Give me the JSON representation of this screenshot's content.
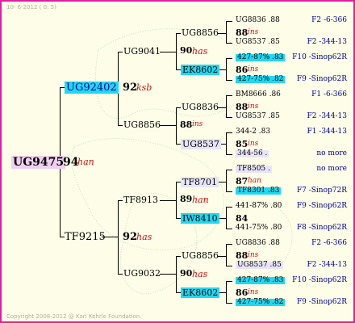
{
  "header": {
    "date_text": "10- 6-2012 ( 0: 5)"
  },
  "footer": {
    "copyright": "Copyright 2008-2012 @ Karl Kehrle Foundation."
  },
  "colors": {
    "border": "#e020a0",
    "background": "#fdfde8",
    "highlight_cyan": "#20d8f0",
    "highlight_lavender": "#e8e4f8",
    "highlight_pink": "#f0d0f0",
    "score_red": "#d01010",
    "info_blue": "#0000a0"
  },
  "root": {
    "name": "UG9475",
    "score": "94",
    "tag": "han"
  },
  "gen1": [
    {
      "name": "UG92402",
      "score": "92",
      "tag": "ksb"
    },
    {
      "name": "TF9215",
      "score": "92",
      "tag": "has"
    }
  ],
  "gen2": [
    {
      "name": "UG9041",
      "score": "90",
      "tag": "has"
    },
    {
      "name": "UG8856",
      "score": "88",
      "tag": "ins"
    },
    {
      "name": "TF8913",
      "score": "89",
      "tag": "han"
    },
    {
      "name": "UG9032",
      "score": "90",
      "tag": "has"
    }
  ],
  "gen3": [
    {
      "name": "UG8856",
      "score": "88",
      "tag": "ins"
    },
    {
      "name": "EK8602",
      "score": "86",
      "tag": "ins"
    },
    {
      "name": "UG8836",
      "score": "88",
      "tag": "ins"
    },
    {
      "name": "UG8537",
      "score": "85",
      "tag": "ins"
    },
    {
      "name": "TF8701",
      "score": "87",
      "tag": "han"
    },
    {
      "name": "IW8410",
      "score": "84",
      "tag": ""
    },
    {
      "name": "UG8856",
      "score": "88",
      "tag": "ins"
    },
    {
      "name": "EK8602",
      "score": "86",
      "tag": "ins"
    }
  ],
  "gen4": [
    {
      "name": "UG8836 .88",
      "info": "F2 -6-366"
    },
    {
      "name": "UG8537 .85",
      "info": "F2 -344-13"
    },
    {
      "name": "427-87% .83",
      "info": "F10 -Sinop62R"
    },
    {
      "name": "427-75% .82",
      "info": "F9 -Sinop62R"
    },
    {
      "name": "BM8666 .86",
      "info": "F1 -6-366"
    },
    {
      "name": "UG8537 .85",
      "info": "F2 -344-13"
    },
    {
      "name": "344-2 .83",
      "info": "F1 -344-13"
    },
    {
      "name": "344-56 .",
      "info": "no more"
    },
    {
      "name": "TF8505 .",
      "info": "no more"
    },
    {
      "name": "TF8301 .83",
      "info": "F7 -Sinop72R"
    },
    {
      "name": "441-87% .80",
      "info": "F9 -Sinop62R"
    },
    {
      "name": "441-75% .80",
      "info": "F8 -Sinop62R"
    },
    {
      "name": "UG8836 .88",
      "info": "F2 -6-366"
    },
    {
      "name": "UG8537 .85",
      "info": "F2 -344-13"
    },
    {
      "name": "427-87% .83",
      "info": "F10 -Sinop62R"
    },
    {
      "name": "427-75% .82",
      "info": "F9 -Sinop62R"
    }
  ]
}
